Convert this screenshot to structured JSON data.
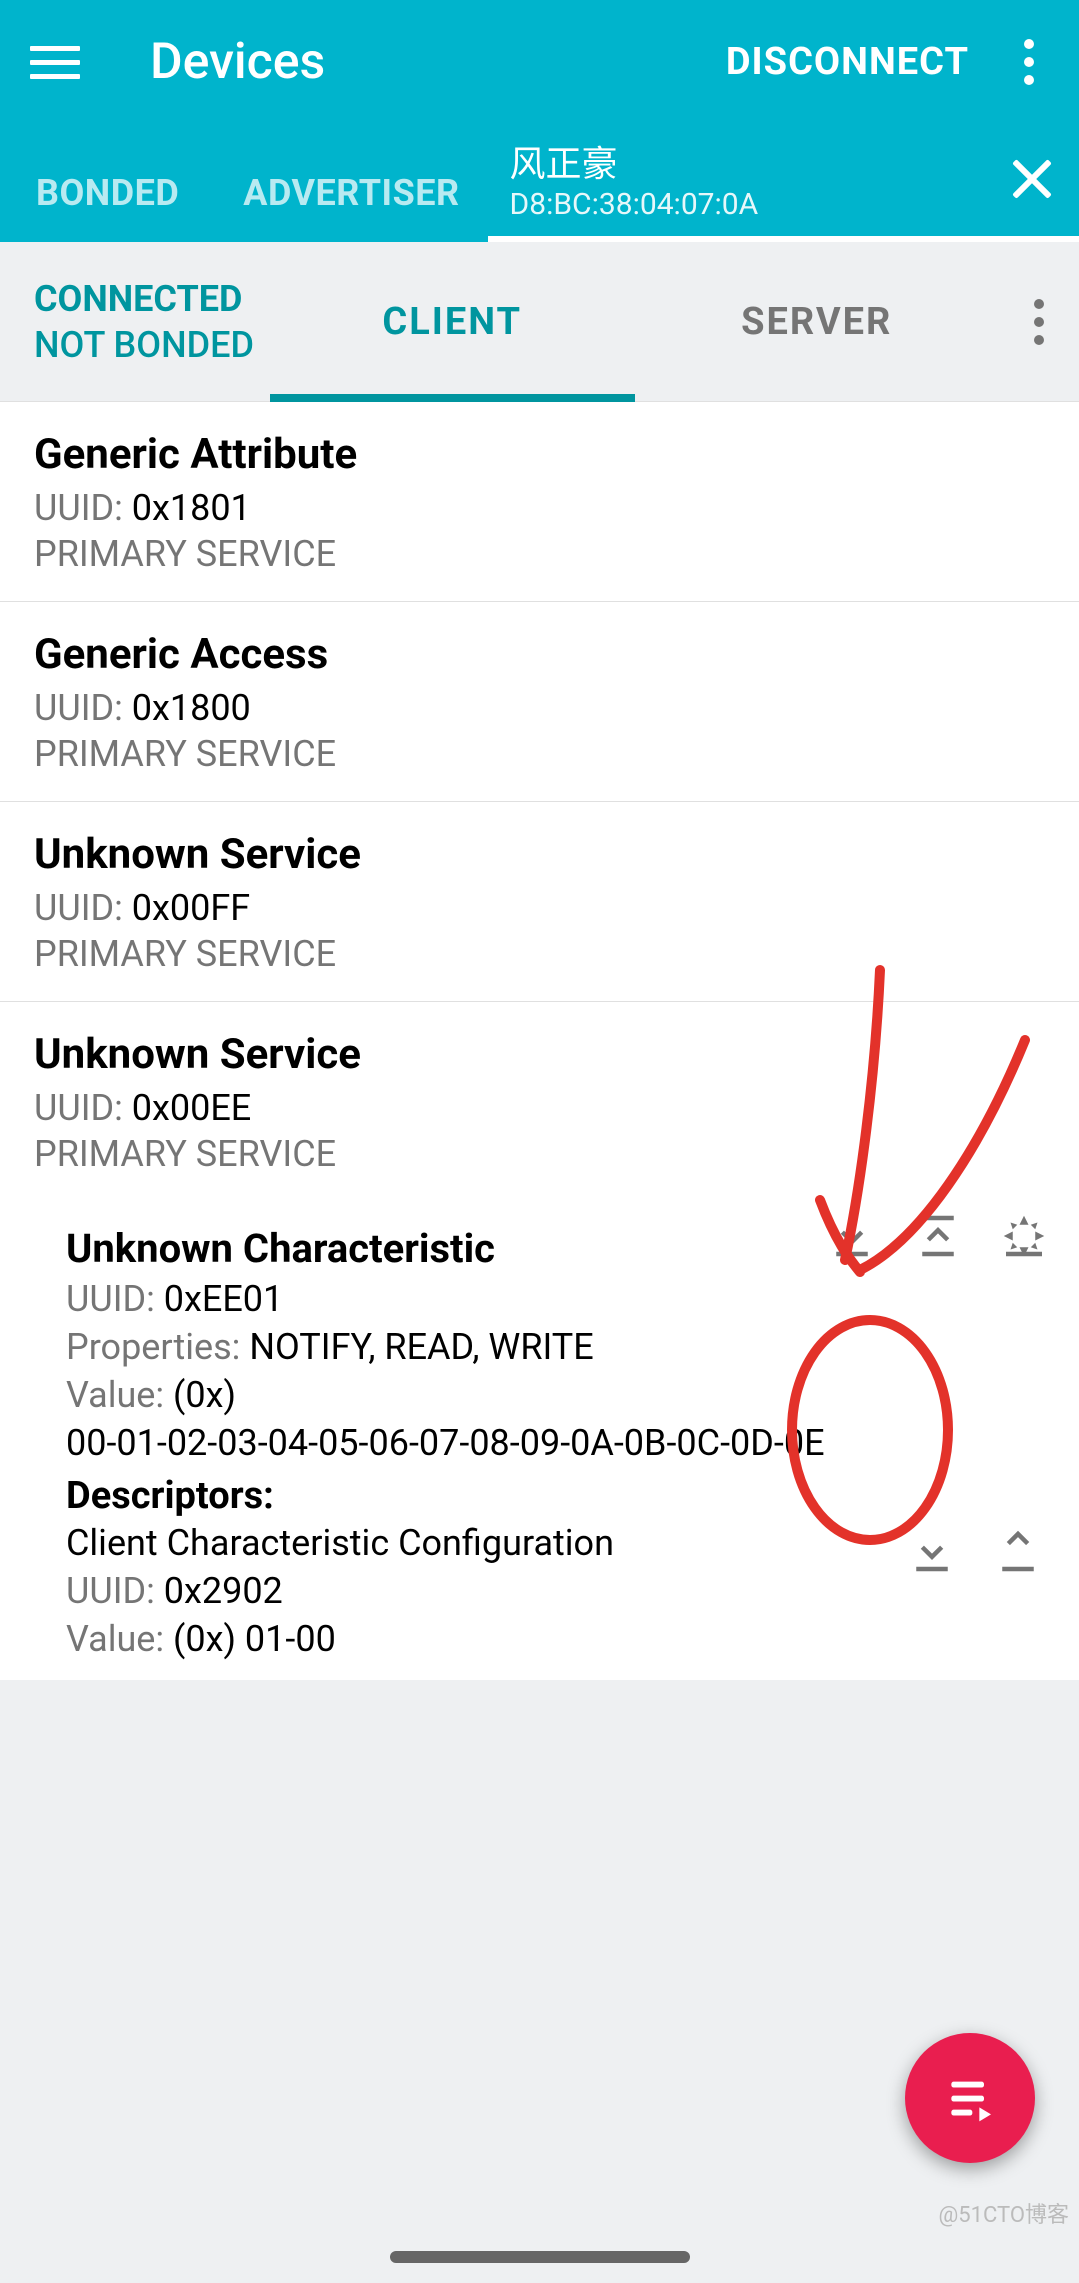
{
  "appbar": {
    "title": "Devices",
    "disconnect": "DISCONNECT"
  },
  "tabs": {
    "bonded": "BONDED",
    "advertiser": "ADVERTISER",
    "device": {
      "name": "风正豪",
      "mac": "D8:BC:38:04:07:0A"
    }
  },
  "status": {
    "connected": "CONNECTED",
    "bonded": "NOT BONDED"
  },
  "subtabs": {
    "client": "CLIENT",
    "server": "SERVER"
  },
  "labels": {
    "uuid": "UUID: ",
    "properties": "Properties: ",
    "value": "Value: ",
    "descriptors": "Descriptors:"
  },
  "services": [
    {
      "name": "Generic Attribute",
      "uuid": "0x1801",
      "type": "PRIMARY SERVICE"
    },
    {
      "name": "Generic Access",
      "uuid": "0x1800",
      "type": "PRIMARY SERVICE"
    },
    {
      "name": "Unknown Service",
      "uuid": "0x00FF",
      "type": "PRIMARY SERVICE"
    },
    {
      "name": "Unknown Service",
      "uuid": "0x00EE",
      "type": "PRIMARY SERVICE",
      "characteristic": {
        "name": "Unknown Characteristic",
        "uuid": "0xEE01",
        "properties": "NOTIFY, READ, WRITE",
        "value_prefix": "(0x)",
        "value_hex": "00-01-02-03-04-05-06-07-08-09-0A-0B-0C-0D-0E",
        "descriptor": {
          "name": "Client Characteristic Configuration",
          "uuid": "0x2902",
          "value": "(0x) 01-00"
        }
      }
    }
  ],
  "watermark": "@51CTO博客"
}
